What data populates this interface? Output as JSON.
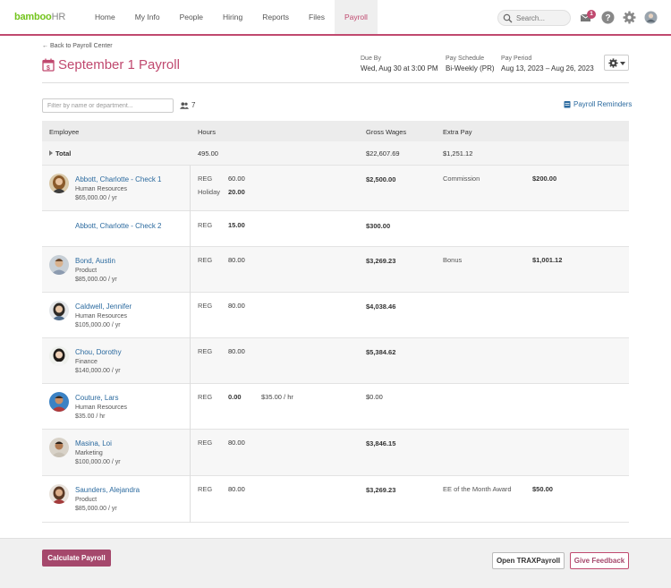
{
  "app": {
    "logo": "bamboo",
    "logo_suffix": "HR",
    "nav": [
      "Home",
      "My Info",
      "People",
      "Hiring",
      "Reports",
      "Files",
      "Payroll"
    ],
    "active_nav": "Payroll",
    "search_placeholder": "Search...",
    "inbox_count": "1",
    "icons": [
      "inbox-icon",
      "help-icon",
      "settings-gear-icon",
      "user-avatar-icon"
    ],
    "accent_color": "#c0496f",
    "brand_green": "#73c41d"
  },
  "header": {
    "back_link": "← Back to Payroll Center",
    "title": "September 1 Payroll",
    "due_by_label": "Due By",
    "due_by_value": "Wed, Aug 30 at 3:00 PM",
    "pay_schedule_label": "Pay Schedule",
    "pay_schedule_value": "Bi-Weekly (PR)",
    "pay_period_label": "Pay Period",
    "pay_period_value": "Aug 13, 2023 – Aug 26, 2023"
  },
  "toolbar": {
    "filter_placeholder": "Filter by name or department...",
    "employee_count": "7",
    "reminders_label": "Payroll Reminders"
  },
  "table": {
    "headers": [
      "Employee",
      "Hours",
      "Gross Wages",
      "Extra Pay"
    ],
    "total": {
      "label": "Total",
      "hours": "495.00",
      "gross": "$22,607.69",
      "extra": "$1,251.12"
    },
    "rows": [
      {
        "name": "Abbott, Charlotte - Check 1",
        "dept": "Human Resources",
        "salary": "$65,000.00 / yr",
        "hours": [
          {
            "type": "REG",
            "value": "60.00"
          },
          {
            "type": "Holiday",
            "value": "20.00"
          }
        ],
        "gross": "$2,500.00",
        "extra_label": "Commission",
        "extra_value": "$200.00"
      },
      {
        "name": "Abbott, Charlotte - Check 2",
        "dept": "",
        "salary": "",
        "hours": [
          {
            "type": "REG",
            "value": "15.00"
          }
        ],
        "gross": "$300.00",
        "extra_label": "",
        "extra_value": ""
      },
      {
        "name": "Bond, Austin",
        "dept": "Product",
        "salary": "$85,000.00 / yr",
        "hours": [
          {
            "type": "REG",
            "value": "80.00"
          }
        ],
        "gross": "$3,269.23",
        "extra_label": "Bonus",
        "extra_value": "$1,001.12"
      },
      {
        "name": "Caldwell, Jennifer",
        "dept": "Human Resources",
        "salary": "$105,000.00 / yr",
        "hours": [
          {
            "type": "REG",
            "value": "80.00"
          }
        ],
        "gross": "$4,038.46",
        "extra_label": "",
        "extra_value": ""
      },
      {
        "name": "Chou, Dorothy",
        "dept": "Finance",
        "salary": "$140,000.00 / yr",
        "hours": [
          {
            "type": "REG",
            "value": "80.00"
          }
        ],
        "gross": "$5,384.62",
        "extra_label": "",
        "extra_value": ""
      },
      {
        "name": "Couture, Lars",
        "dept": "Human Resources",
        "salary": "$35.00 / hr",
        "hours": [
          {
            "type": "REG",
            "value": "0.00"
          }
        ],
        "rate": "$35.00",
        "rate_unit": "/ hr",
        "gross": "$0.00",
        "extra_label": "",
        "extra_value": ""
      },
      {
        "name": "Masina, Loi",
        "dept": "Marketing",
        "salary": "$100,000.00 / yr",
        "hours": [
          {
            "type": "REG",
            "value": "80.00"
          }
        ],
        "gross": "$3,846.15",
        "extra_label": "",
        "extra_value": ""
      },
      {
        "name": "Saunders, Alejandra",
        "dept": "Product",
        "salary": "$85,000.00 / yr",
        "hours": [
          {
            "type": "REG",
            "value": "80.00"
          }
        ],
        "gross": "$3,269.23",
        "extra_label": "EE of the Month Award",
        "extra_value": "$50.00"
      }
    ]
  },
  "footer": {
    "calculate_label": "Calculate Payroll",
    "trax_label": "Open TRAXPayroll",
    "feedback_label": "Give Feedback"
  }
}
